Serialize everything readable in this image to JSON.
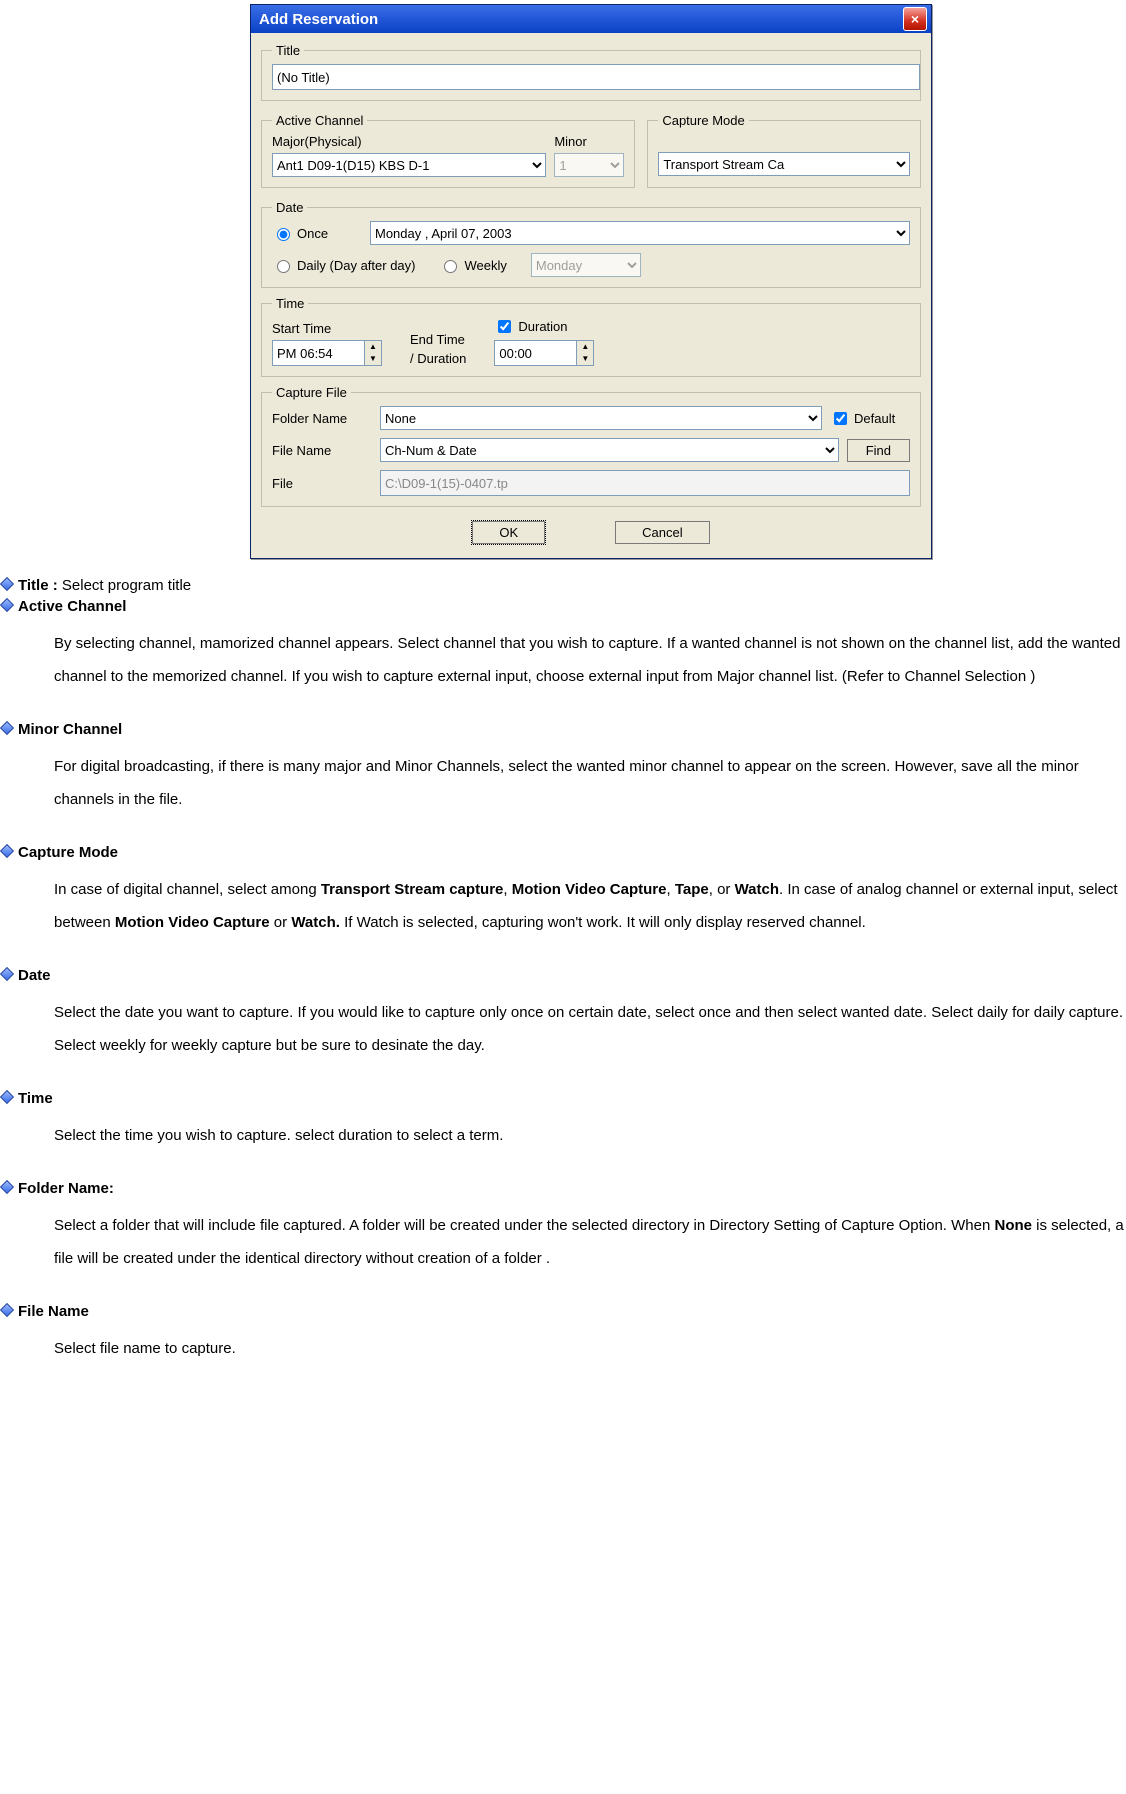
{
  "dialog": {
    "title": "Add Reservation",
    "close_icon": "×",
    "title_group": {
      "legend": "Title",
      "value": "(No Title)"
    },
    "active_channel": {
      "legend": "Active Channel",
      "major_label": "Major(Physical)",
      "major_value": "Ant1 D09-1(D15) KBS D-1",
      "minor_label": "Minor",
      "minor_value": "1"
    },
    "capture_mode": {
      "legend": "Capture Mode",
      "value": "Transport Stream Ca"
    },
    "date": {
      "legend": "Date",
      "once_label": "Once",
      "once_value": "Monday   ,     April     07, 2003",
      "daily_label": "Daily (Day after day)",
      "weekly_label": "Weekly",
      "weekly_value": "Monday"
    },
    "time": {
      "legend": "Time",
      "start_label": "Start Time",
      "start_value": "PM 06:54",
      "end_label_line1": "End Time",
      "end_label_line2": "/ Duration",
      "duration_label": "Duration",
      "duration_value": "00:00"
    },
    "capture_file": {
      "legend": "Capture File",
      "folder_label": "Folder Name",
      "folder_value": "None",
      "default_label": "Default",
      "filename_label": "File Name",
      "filename_value": "Ch-Num & Date",
      "find_label": "Find",
      "file_label": "File",
      "file_value": "C:\\D09-1(15)-0407.tp"
    },
    "buttons": {
      "ok": "OK",
      "cancel": "Cancel"
    }
  },
  "help": {
    "title_line_bold": "Title :",
    "title_line_rest": " Select program   title",
    "active_channel_h": "Active Channel",
    "active_channel_body": "By selecting channel, mamorized channel appears. Select channel that you wish to capture. If a wanted channel is not shown on  the channel list, add the wanted channel to the memorized channel. If you wish to capture external input, choose external input from   Major channel list. (Refer to Channel Selection )",
    "minor_channel_h": "Minor Channel",
    "minor_channel_body": "For digital broadcasting, if there is many major and Minor Channels, select the wanted minor channel to appear on the screen. However, save all the minor channels in the file.",
    "capture_mode_h": "Capture Mode",
    "capture_mode_body_1": "In case of digital channel, select among ",
    "capture_mode_body_b1": "Transport Stream capture",
    "capture_mode_body_2": ", ",
    "capture_mode_body_b2": "Motion Video Capture",
    "capture_mode_body_3": ", ",
    "capture_mode_body_b3": "Tape",
    "capture_mode_body_4": ", or ",
    "capture_mode_body_b4": "Watch",
    "capture_mode_body_5": ". In case of analog channel or external input, select between ",
    "capture_mode_body_b5": "Motion Video Capture",
    "capture_mode_body_6": " or ",
    "capture_mode_body_b6": "Watch.",
    "capture_mode_body_7": " If Watch is selected, capturing won't work. It will only display reserved channel.",
    "date_h": "Date",
    "date_body": "Select the date you want to capture. If you would like to capture only once on certain date, select once and then select wanted date.  Select daily for daily capture. Select weekly for weekly capture but be sure to desinate the day.",
    "time_h": "Time",
    "time_body": "Select the time you wish to capture. select duration to select a term.",
    "folder_h": "Folder Name:",
    "folder_body_1": "Select a folder that will include file captured.   A folder will be created under the selected directory in Directory Setting of Capture Option.   When ",
    "folder_body_b": "None",
    "folder_body_2": " is selected, a file will be created under the identical directory without creation of a folder .",
    "filename_h": "File Name",
    "filename_body": "Select file name to capture."
  }
}
